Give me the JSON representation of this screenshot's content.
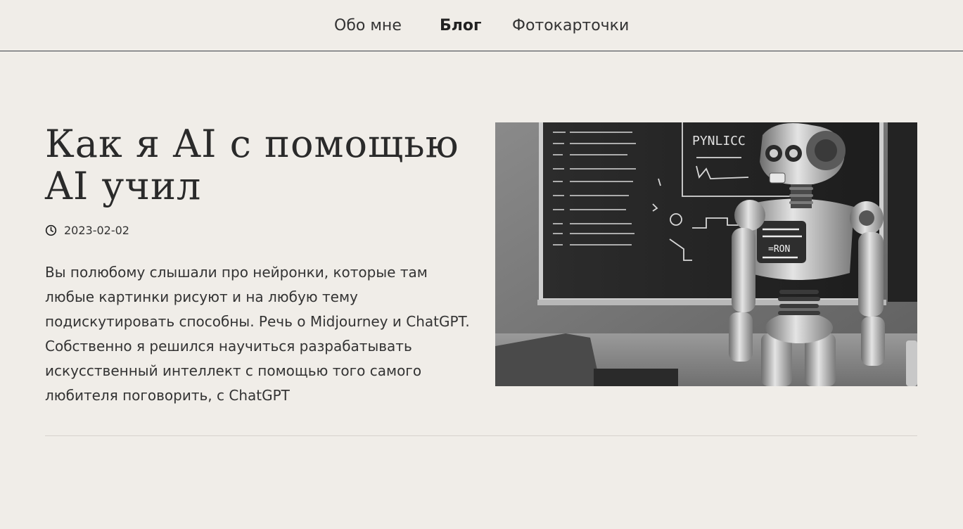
{
  "nav": {
    "items": [
      {
        "label": "Обо мне"
      },
      {
        "label": "Блог"
      },
      {
        "label": "Фотокарточки"
      }
    ],
    "active": "Блог"
  },
  "post": {
    "title": "Как я AI с помощью AI учил",
    "date": "2023-02-02",
    "date_icon": "clock-icon",
    "excerpt": "Вы полюбому слышали про нейронки, которые там любые картинки рисуют и на любую тему подискутировать способны. Речь о Midjourney и ChatGPT. Собственно я решился научиться разрабатывать искусственный интеллект с помощью того самого любителя поговорить, с ChatGPT",
    "image": {
      "subject": "robot-at-chalkboard",
      "board_text": "PYNLICC",
      "screen_text": "=RON"
    }
  },
  "colors": {
    "background": "#f0ede8",
    "text": "#2b2b2b",
    "nav_border": "#3a3f47",
    "divider": "#d6d2cc"
  }
}
